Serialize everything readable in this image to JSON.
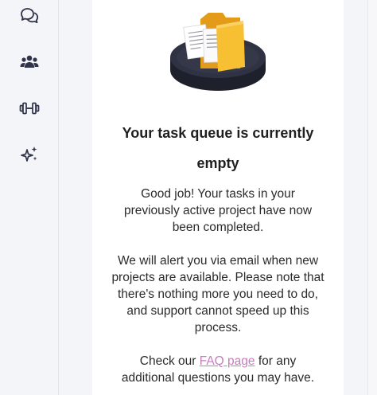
{
  "sidebar": {
    "items": [
      {
        "icon": "chat-bubbles-icon"
      },
      {
        "icon": "team-icon"
      },
      {
        "icon": "dumbbell-icon"
      },
      {
        "icon": "sparkles-icon"
      }
    ]
  },
  "empty_state": {
    "title": "Your task queue is currently empty",
    "message_1": "Good job! Your tasks in your previously active project have now been completed.",
    "message_2": "We will alert you via email when new projects are available. Please note that there's nothing more you need to do, and support cannot speed up this process.",
    "faq_prefix": "Check our ",
    "faq_link": "FAQ page",
    "faq_suffix": " for any additional questions you may have."
  },
  "colors": {
    "link": "#c77dbd",
    "folder": "#f5b82e",
    "platform": "#2d2f3d"
  }
}
